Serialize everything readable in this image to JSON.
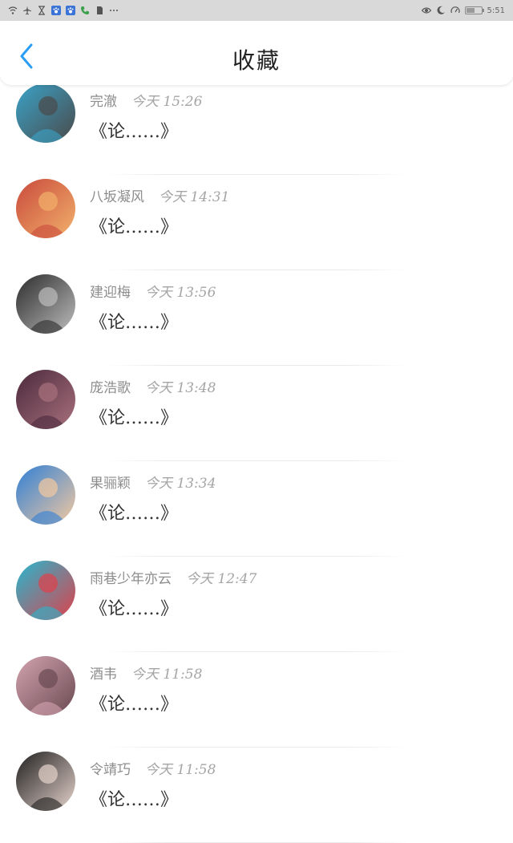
{
  "status_bar": {
    "left_icons": [
      "wifi-icon",
      "airplane-icon",
      "hourglass-icon",
      "paw-icon",
      "paw-icon-2",
      "phone-icon",
      "sim-icon",
      "more-icon"
    ],
    "right_icons": [
      "eye-icon",
      "moon-icon",
      "speed-icon",
      "battery-icon"
    ],
    "battery_level": 0.6,
    "time": "5:51"
  },
  "header": {
    "title": "收藏",
    "back_icon": "chevron-left-icon",
    "accent": "#2a9df4"
  },
  "items": [
    {
      "name": "完澈",
      "time": "今天 15:26",
      "content": "《论……》",
      "avatar_colors": [
        "#3aa3c8",
        "#4a4a4a"
      ]
    },
    {
      "name": "八坂凝风",
      "time": "今天 14:31",
      "content": "《论……》",
      "avatar_colors": [
        "#c94a3c",
        "#f2b16b"
      ]
    },
    {
      "name": "建迎梅",
      "time": "今天 13:56",
      "content": "《论……》",
      "avatar_colors": [
        "#2b2b2b",
        "#bdbdbd"
      ]
    },
    {
      "name": "庞浩歌",
      "time": "今天 13:48",
      "content": "《论……》",
      "avatar_colors": [
        "#4b2a3c",
        "#a8707d"
      ]
    },
    {
      "name": "果骊颖",
      "time": "今天 13:34",
      "content": "《论……》",
      "avatar_colors": [
        "#2f7fd6",
        "#f4c9a0"
      ]
    },
    {
      "name": "雨巷少年亦云",
      "time": "今天 12:47",
      "content": "《论……》",
      "avatar_colors": [
        "#26b7cf",
        "#e0404a"
      ]
    },
    {
      "name": "酒韦",
      "time": "今天 11:58",
      "content": "《论……》",
      "avatar_colors": [
        "#d3a3b0",
        "#6a4a52"
      ]
    },
    {
      "name": "令靖巧",
      "time": "今天 11:58",
      "content": "《论……》",
      "avatar_colors": [
        "#1f1f1f",
        "#e6d3cc"
      ]
    }
  ]
}
